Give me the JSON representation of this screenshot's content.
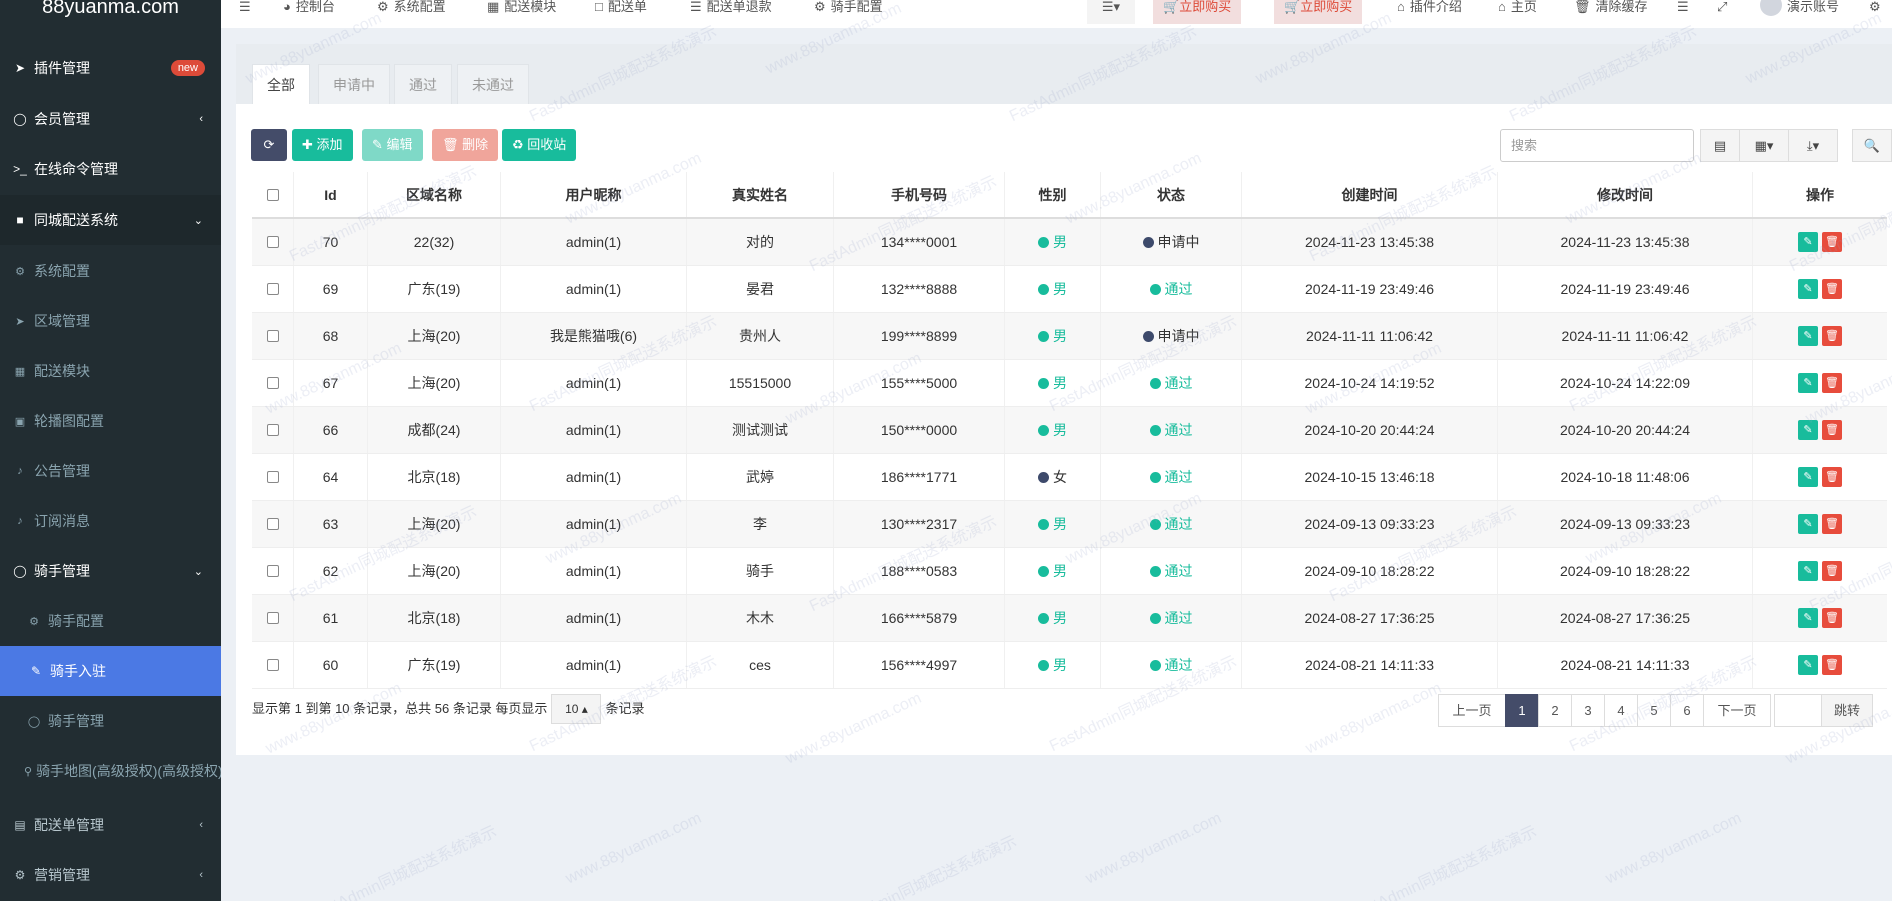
{
  "sidebar": {
    "logo": "88yuanma.com",
    "badge": "new",
    "items": [
      {
        "label": "插件管理",
        "icon": "rocket-icon"
      },
      {
        "label": "会员管理",
        "icon": "user-circle-icon"
      },
      {
        "label": "在线命令管理",
        "icon": "terminal-icon"
      },
      {
        "label": "同城配送系统",
        "icon": "folder-icon"
      },
      {
        "label": "系统配置",
        "icon": "cogs-icon"
      },
      {
        "label": "区域管理",
        "icon": "location-arrow-icon"
      },
      {
        "label": "配送模块",
        "icon": "th-large-icon"
      },
      {
        "label": "轮播图配置",
        "icon": "image-icon"
      },
      {
        "label": "公告管理",
        "icon": "bell-icon"
      },
      {
        "label": "订阅消息",
        "icon": "bell-icon"
      },
      {
        "label": "骑手管理",
        "icon": "user-circle-icon"
      },
      {
        "label": "骑手配置",
        "icon": "cog-icon"
      },
      {
        "label": "骑手入驻",
        "icon": "edit-icon"
      },
      {
        "label": "骑手管理",
        "icon": "user-circle-icon"
      },
      {
        "label": "骑手地图(高级授权)(高级授权)",
        "icon": "map-marker-icon"
      },
      {
        "label": "配送单管理",
        "icon": "list-alt-icon"
      },
      {
        "label": "营销管理",
        "icon": "gear-icon"
      }
    ]
  },
  "topnav": {
    "items": [
      "控制台",
      "系统配置",
      "配送模块",
      "配送单",
      "配送单退款",
      "骑手配置"
    ],
    "buy1": "立即购买",
    "buy2": "立即购买",
    "plugin_intro": "插件介绍",
    "home": "主页",
    "clear_cache": "清除缓存",
    "account": "演示账号"
  },
  "tabs": [
    "全部",
    "申请中",
    "通过",
    "未通过"
  ],
  "toolbar": {
    "add": "添加",
    "edit": "编辑",
    "delete": "删除",
    "recycle": "回收站",
    "search_placeholder": "搜索"
  },
  "table": {
    "headers": [
      "Id",
      "区域名称",
      "用户昵称",
      "真实姓名",
      "手机号码",
      "性别",
      "状态",
      "创建时间",
      "修改时间",
      "操作"
    ],
    "rows": [
      {
        "id": "70",
        "area": "22(32)",
        "nick": "admin(1)",
        "name": "对的",
        "phone": "134****0001",
        "gender": "男",
        "gcolor": "green",
        "status": "申请中",
        "scolor": "navy",
        "created": "2024-11-23 13:45:38",
        "updated": "2024-11-23 13:45:38"
      },
      {
        "id": "69",
        "area": "广东(19)",
        "nick": "admin(1)",
        "name": "晏君",
        "phone": "132****8888",
        "gender": "男",
        "gcolor": "green",
        "status": "通过",
        "scolor": "green",
        "created": "2024-11-19 23:49:46",
        "updated": "2024-11-19 23:49:46"
      },
      {
        "id": "68",
        "area": "上海(20)",
        "nick": "我是熊猫哦(6)",
        "name": "贵州人",
        "phone": "199****8899",
        "gender": "男",
        "gcolor": "green",
        "status": "申请中",
        "scolor": "navy",
        "created": "2024-11-11 11:06:42",
        "updated": "2024-11-11 11:06:42"
      },
      {
        "id": "67",
        "area": "上海(20)",
        "nick": "admin(1)",
        "name": "15515000",
        "phone": "155****5000",
        "gender": "男",
        "gcolor": "green",
        "status": "通过",
        "scolor": "green",
        "created": "2024-10-24 14:19:52",
        "updated": "2024-10-24 14:22:09"
      },
      {
        "id": "66",
        "area": "成都(24)",
        "nick": "admin(1)",
        "name": "测试测试",
        "phone": "150****0000",
        "gender": "男",
        "gcolor": "green",
        "status": "通过",
        "scolor": "green",
        "created": "2024-10-20 20:44:24",
        "updated": "2024-10-20 20:44:24"
      },
      {
        "id": "64",
        "area": "北京(18)",
        "nick": "admin(1)",
        "name": "武婷",
        "phone": "186****1771",
        "gender": "女",
        "gcolor": "navy",
        "status": "通过",
        "scolor": "green",
        "created": "2024-10-15 13:46:18",
        "updated": "2024-10-18 11:48:06"
      },
      {
        "id": "63",
        "area": "上海(20)",
        "nick": "admin(1)",
        "name": "李",
        "phone": "130****2317",
        "gender": "男",
        "gcolor": "green",
        "status": "通过",
        "scolor": "green",
        "created": "2024-09-13 09:33:23",
        "updated": "2024-09-13 09:33:23"
      },
      {
        "id": "62",
        "area": "上海(20)",
        "nick": "admin(1)",
        "name": "骑手",
        "phone": "188****0583",
        "gender": "男",
        "gcolor": "green",
        "status": "通过",
        "scolor": "green",
        "created": "2024-09-10 18:28:22",
        "updated": "2024-09-10 18:28:22"
      },
      {
        "id": "61",
        "area": "北京(18)",
        "nick": "admin(1)",
        "name": "木木",
        "phone": "166****5879",
        "gender": "男",
        "gcolor": "green",
        "status": "通过",
        "scolor": "green",
        "created": "2024-08-27 17:36:25",
        "updated": "2024-08-27 17:36:25"
      },
      {
        "id": "60",
        "area": "广东(19)",
        "nick": "admin(1)",
        "name": "ces",
        "phone": "156****4997",
        "gender": "男",
        "gcolor": "green",
        "status": "通过",
        "scolor": "green",
        "created": "2024-08-21 14:11:33",
        "updated": "2024-08-21 14:11:33"
      }
    ]
  },
  "footer": {
    "summary": "显示第 1 到第 10 条记录，总共 56 条记录 每页显示",
    "per_page": "10",
    "suffix": "条记录",
    "prev": "上一页",
    "pages": [
      "1",
      "2",
      "3",
      "4",
      "5",
      "6"
    ],
    "next": "下一页",
    "jump": "跳转"
  },
  "watermark": {
    "text1": "www.88yuanma.com",
    "text2": "FastAdmin同城配送系统演示"
  },
  "colors": {
    "sidebar_bg": "#222d32",
    "active": "#4b79e4",
    "green": "#18bc9c",
    "navy": "#3d4a6b",
    "red": "#e74c3c"
  }
}
